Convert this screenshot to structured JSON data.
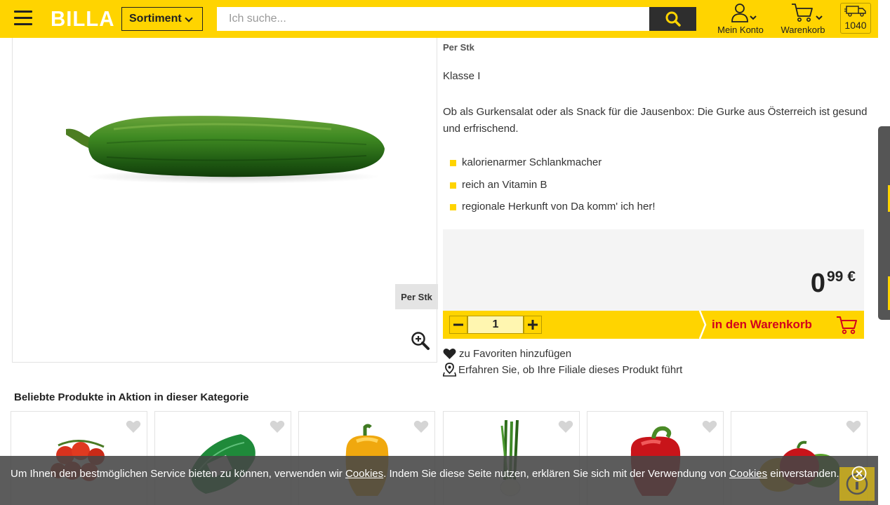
{
  "header": {
    "logo": "BILLA",
    "sortiment_label": "Sortiment",
    "search_placeholder": "Ich suche...",
    "account_label": "Mein Konto",
    "cart_label": "Warenkorb",
    "delivery_zip": "1040",
    "brand_color": "#ffd400"
  },
  "product": {
    "unit": "Per Stk",
    "badge_unit": "Per Stk",
    "klasse": "Klasse I",
    "description": "Ob als Gurkensalat oder als Snack für die Jausenbox: Die Gurke aus Österreich ist gesund und erfrischend.",
    "bullets": [
      "kalorienarmer Schlankmacher",
      "reich an Vitamin B",
      "regionale Herkunft von Da komm' ich her!"
    ],
    "price_int": "0",
    "price_cents": "99",
    "currency": "€",
    "quantity": "1",
    "add_to_cart_label": "in den Warenkorb",
    "favorite_label": "zu Favoriten hinzufügen",
    "store_check_label": "Erfahren Sie, ob Ihre Filiale dieses Produkt führt"
  },
  "popular": {
    "title": "Beliebte Produkte in Aktion in dieser Kategorie"
  },
  "cookie": {
    "text_1": "Um Ihnen den bestmöglichen Service bieten zu können, verwenden wir ",
    "link_1": "Cookies",
    "text_2": ". Indem Sie diese Seite nutzen, erklären Sie sich mit der Verwendung von ",
    "link_2": "Cookies",
    "text_3": " einverstanden."
  }
}
